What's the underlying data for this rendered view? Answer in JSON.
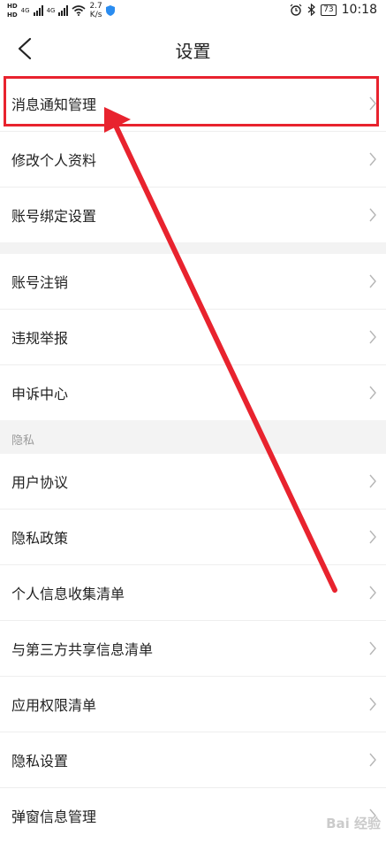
{
  "status_bar": {
    "hd1": "HD",
    "hd2": "HD",
    "network": "4G",
    "network2": "4G",
    "speed_value": "2.7",
    "speed_unit": "K/s",
    "battery": "73",
    "time": "10:18"
  },
  "header": {
    "title": "设置"
  },
  "group1": [
    {
      "label": "消息通知管理"
    },
    {
      "label": "修改个人资料"
    },
    {
      "label": "账号绑定设置"
    }
  ],
  "group2": [
    {
      "label": "账号注销"
    },
    {
      "label": "违规举报"
    },
    {
      "label": "申诉中心"
    }
  ],
  "privacy_section": {
    "header": "隐私",
    "items": [
      {
        "label": "用户协议"
      },
      {
        "label": "隐私政策"
      },
      {
        "label": "个人信息收集清单"
      },
      {
        "label": "与第三方共享信息清单"
      },
      {
        "label": "应用权限清单"
      },
      {
        "label": "隐私设置"
      },
      {
        "label": "弹窗信息管理"
      }
    ]
  },
  "watermark": "Bai 经验",
  "colors": {
    "annotation": "#e8232e",
    "divider": "#eeeeee",
    "gap": "#f3f3f3"
  }
}
